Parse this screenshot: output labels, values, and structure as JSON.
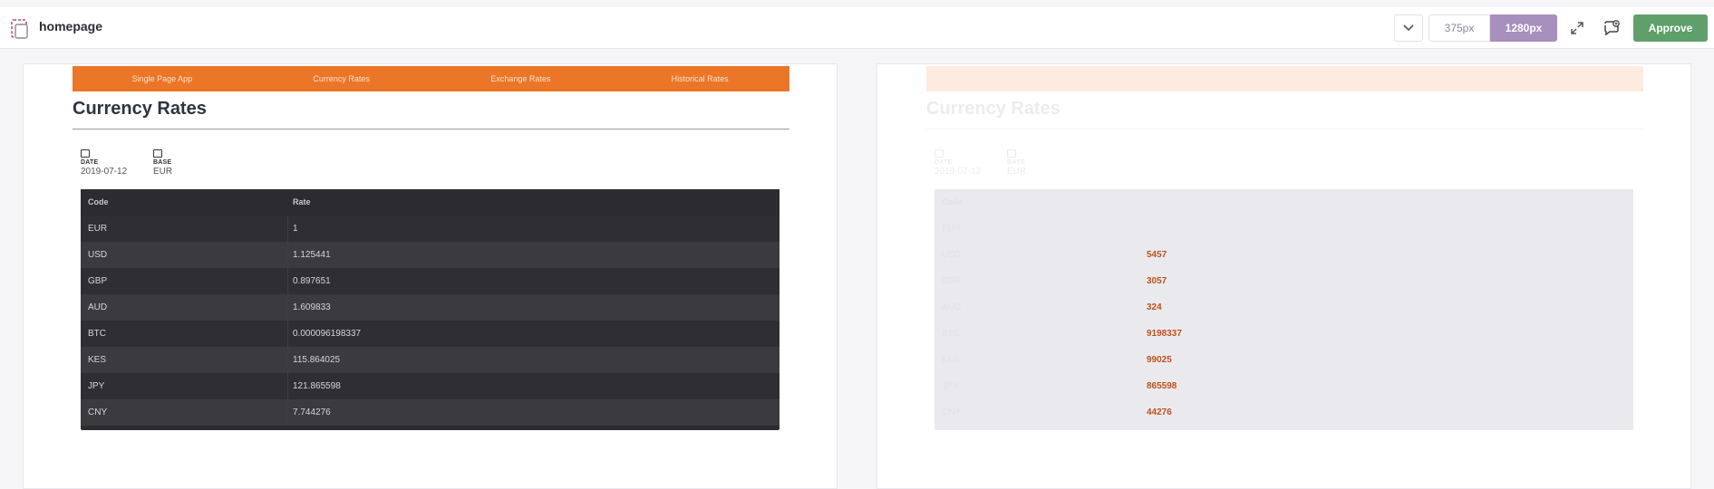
{
  "app": {
    "page_name": "homepage",
    "viewport_small": "375px",
    "viewport_large": "1280px",
    "approve_label": "Approve",
    "accent_color": "#a78fbe",
    "approve_color": "#5f9f6a"
  },
  "site": {
    "nav": [
      "Single Page App",
      "Currency Rates",
      "Exchange Rates",
      "Historical Rates"
    ],
    "nav_color": "#ec7628",
    "title": "Currency Rates",
    "date_label": "DATE",
    "date_value": "2019-07-12",
    "base_label": "BASE",
    "base_value": "EUR",
    "table": {
      "headers": [
        "Code",
        "Rate"
      ],
      "rows": [
        [
          "EUR",
          "1"
        ],
        [
          "USD",
          "1.125441"
        ],
        [
          "GBP",
          "0.897651"
        ],
        [
          "AUD",
          "1.609833"
        ],
        [
          "BTC",
          "0.000096198337"
        ],
        [
          "KES",
          "115.864025"
        ],
        [
          "JPY",
          "121.865598"
        ],
        [
          "CNY",
          "7.744276"
        ]
      ]
    }
  },
  "diff": {
    "rates": [
      "",
      "",
      "5457",
      "3057",
      "324",
      "9198337",
      "99025",
      "865598",
      "44276"
    ]
  }
}
